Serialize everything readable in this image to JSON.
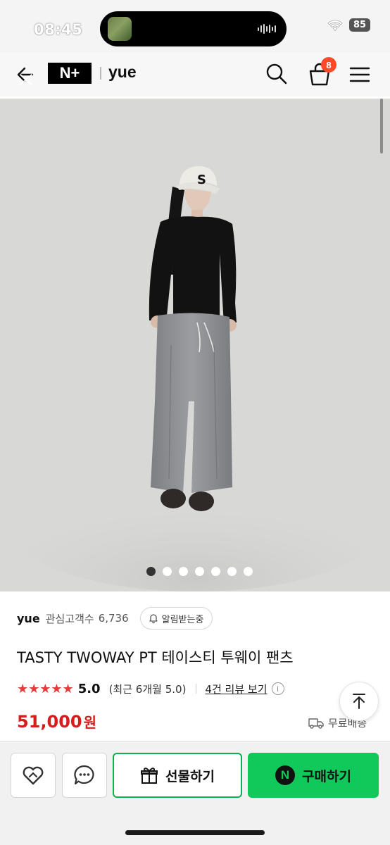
{
  "status_bar": {
    "time": "08:45",
    "battery": "85"
  },
  "nav": {
    "brand_logo": "N+",
    "store_name": "yue",
    "cart_count": "8"
  },
  "gallery": {
    "image_count": 7,
    "active_index": 0
  },
  "product": {
    "shop_name": "yue",
    "fans_label": "관심고객수",
    "fans_count": "6,736",
    "notify_label": "알림받는중",
    "title": "TASTY TWOWAY PT 테이스티 투웨이 팬츠",
    "stars": "★★★★★",
    "rating": "5.0",
    "rating_recent": "(최근 6개월 5.0)",
    "review_link": "4건 리뷰 보기",
    "price": "51,000",
    "price_unit": "원",
    "shipping": "무료배송"
  },
  "actions": {
    "gift_label": "선물하기",
    "buy_label": "구매하기"
  },
  "colors": {
    "accent_green": "#10c95a",
    "price_red": "#d81b1b",
    "star_red": "#e23c3c",
    "badge_orange": "#ff4a2a"
  }
}
